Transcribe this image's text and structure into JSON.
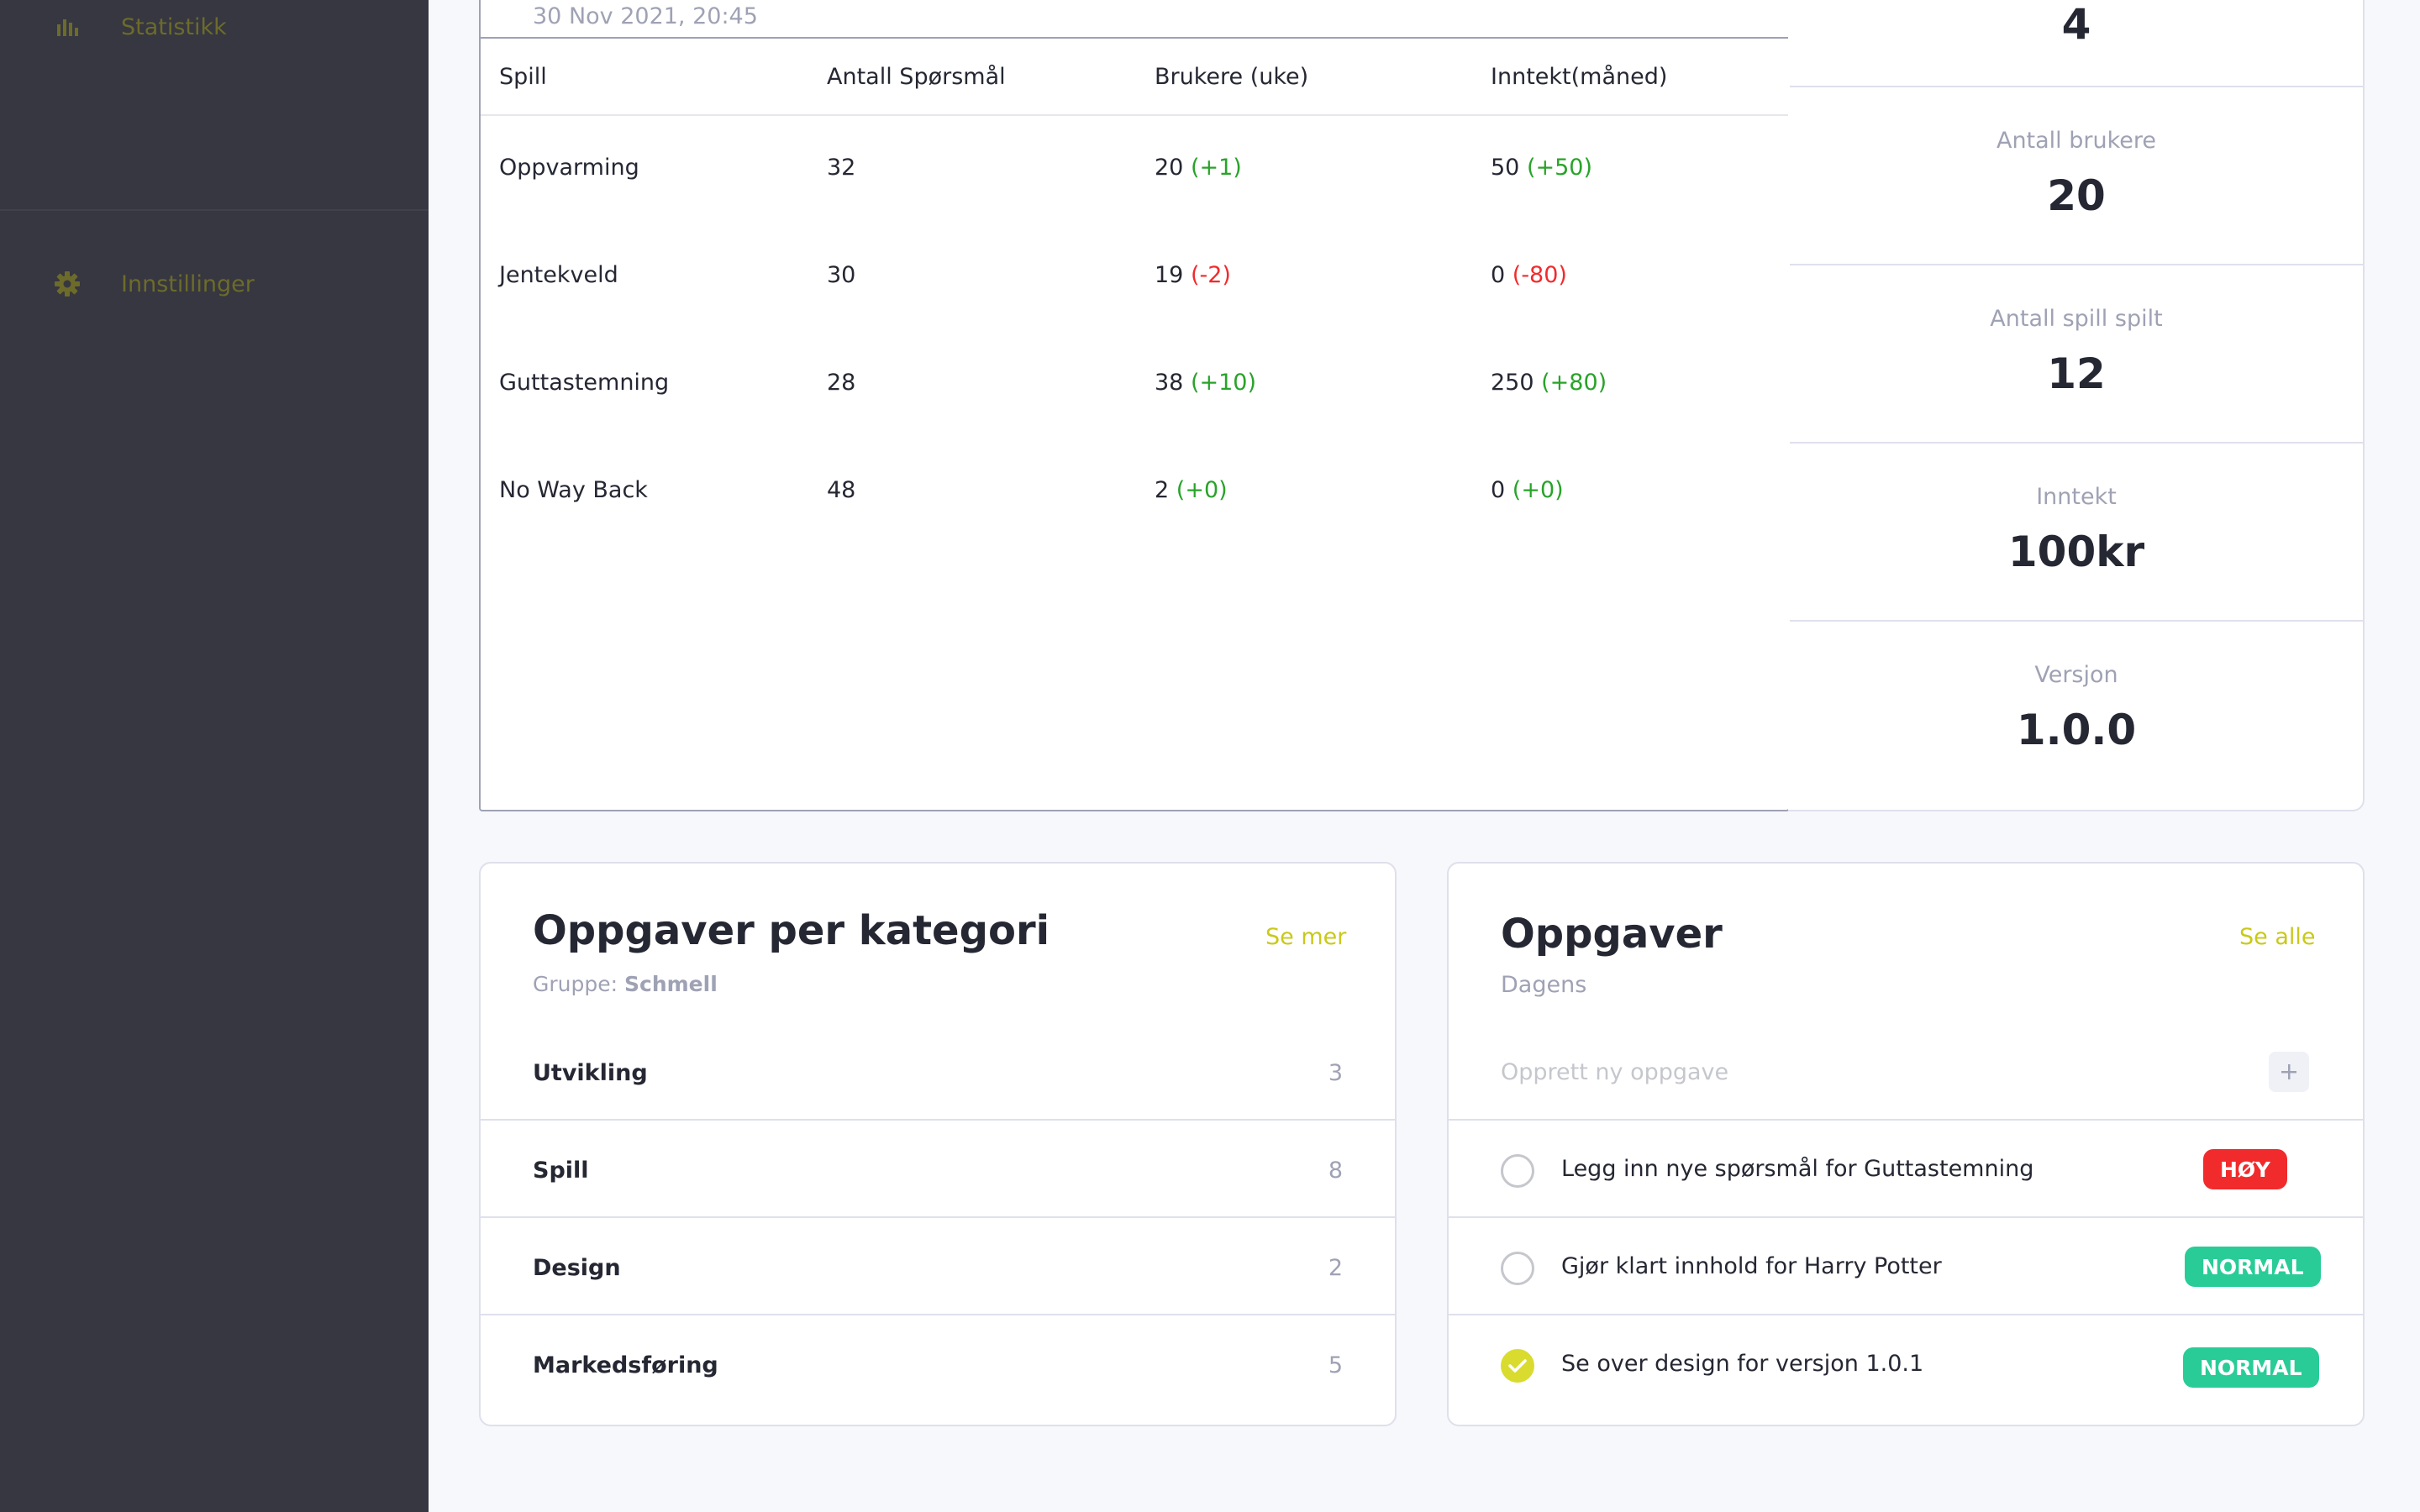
{
  "sidebar": {
    "items": [
      {
        "label": "Statistikk",
        "icon": "bar-chart-icon"
      },
      {
        "label": "Innstillinger",
        "icon": "gear-icon"
      }
    ]
  },
  "games_table": {
    "date": "30 Nov 2021, 20:45",
    "headers": [
      "Spill",
      "Antall Spørsmål",
      "Brukere (uke)",
      "Inntekt(måned)"
    ],
    "rows": [
      {
        "game": "Oppvarming",
        "questions": "32",
        "users": "20",
        "users_change": "(+1)",
        "users_trend": "pos",
        "income": "50",
        "income_change": "(+50)",
        "income_trend": "pos"
      },
      {
        "game": "Jentekveld",
        "questions": "30",
        "users": "19",
        "users_change": "(-2)",
        "users_trend": "neg",
        "income": "0",
        "income_change": "(-80)",
        "income_trend": "neg"
      },
      {
        "game": "Guttastemning",
        "questions": "28",
        "users": "38",
        "users_change": "(+10)",
        "users_trend": "pos",
        "income": "250",
        "income_change": "(+80)",
        "income_trend": "pos"
      },
      {
        "game": "No Way Back",
        "questions": "48",
        "users": "2",
        "users_change": "(+0)",
        "users_trend": "pos",
        "income": "0",
        "income_change": "(+0)",
        "income_trend": "pos"
      }
    ]
  },
  "stats": [
    {
      "label": "",
      "value": "4"
    },
    {
      "label": "Antall brukere",
      "value": "20"
    },
    {
      "label": "Antall spill spilt",
      "value": "12"
    },
    {
      "label": "Inntekt",
      "value": "100kr"
    },
    {
      "label": "Versjon",
      "value": "1.0.0"
    }
  ],
  "categories": {
    "title": "Oppgaver per kategori",
    "group_label": "Gruppe:",
    "group_name": "Schmell",
    "link": "Se mer",
    "items": [
      {
        "label": "Utvikling",
        "count": "3"
      },
      {
        "label": "Spill",
        "count": "8"
      },
      {
        "label": "Design",
        "count": "2"
      },
      {
        "label": "Markedsføring",
        "count": "5"
      }
    ]
  },
  "tasks": {
    "title": "Oppgaver",
    "subtitle": "Dagens",
    "link": "Se alle",
    "new_placeholder": "Opprett ny oppgave",
    "items": [
      {
        "text": "Legg inn nye spørsmål for Guttastemning",
        "priority": "HØY",
        "done": false
      },
      {
        "text": "Gjør klart innhold for Harry Potter",
        "priority": "NORMAL",
        "done": false
      },
      {
        "text": "Se over design for versjon 1.0.1",
        "priority": "NORMAL",
        "done": true
      }
    ]
  },
  "colors": {
    "sidebar_bg": "#363740",
    "accent": "#c9c91a",
    "positive": "#29a329",
    "negative": "#f12b2c",
    "badge_high": "#f12b2c",
    "badge_normal": "#29cc97"
  }
}
